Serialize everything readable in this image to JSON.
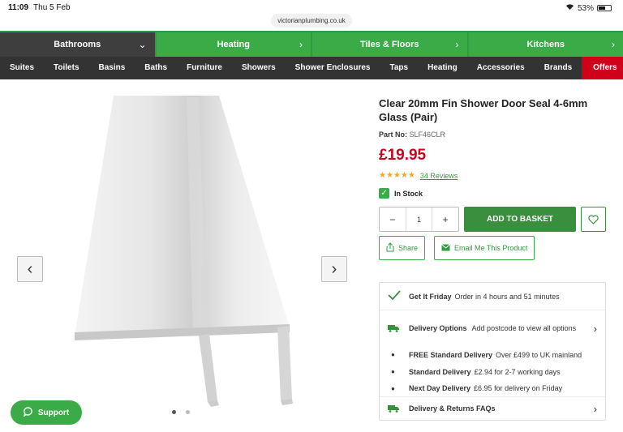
{
  "status": {
    "time": "11:09",
    "date": "Thu 5 Feb",
    "url": "victorianplumbing.co.uk",
    "battery": "53%"
  },
  "topnav": [
    {
      "label": "Bathrooms",
      "chev": "⌄"
    },
    {
      "label": "Heating",
      "chev": "›"
    },
    {
      "label": "Tiles & Floors",
      "chev": "›"
    },
    {
      "label": "Kitchens",
      "chev": "›"
    }
  ],
  "subnav": [
    "Suites",
    "Toilets",
    "Basins",
    "Baths",
    "Furniture",
    "Showers",
    "Shower Enclosures",
    "Taps",
    "Heating",
    "Accessories",
    "Brands",
    "Offers"
  ],
  "gallery": {
    "prev": "‹",
    "next": "›",
    "support": "Support"
  },
  "product": {
    "title": "Clear 20mm Fin Shower Door Seal 4-6mm Glass (Pair)",
    "part_label": "Part No:",
    "part_no": "SLF46CLR",
    "price": "£19.95",
    "stars": "★★★★★",
    "reviews": "34 Reviews",
    "stock": "In Stock",
    "qty": "1",
    "minus": "−",
    "plus": "+",
    "add_basket": "ADD TO BASKET",
    "share": "Share",
    "email": "Email Me This Product"
  },
  "delivery": {
    "friday_bold": "Get It Friday",
    "friday_text": "Order in 4 hours and 51 minutes",
    "options_bold": "Delivery Options",
    "options_text": "Add postcode to view all options",
    "free_bold": "FREE Standard Delivery",
    "free_text": "Over £499 to UK mainland",
    "std_bold": "Standard Delivery",
    "std_text": "£2.94 for 2-7 working days",
    "next_bold": "Next Day Delivery",
    "next_text": "£6.95 for delivery on Friday",
    "faq": "Delivery & Returns FAQs"
  }
}
